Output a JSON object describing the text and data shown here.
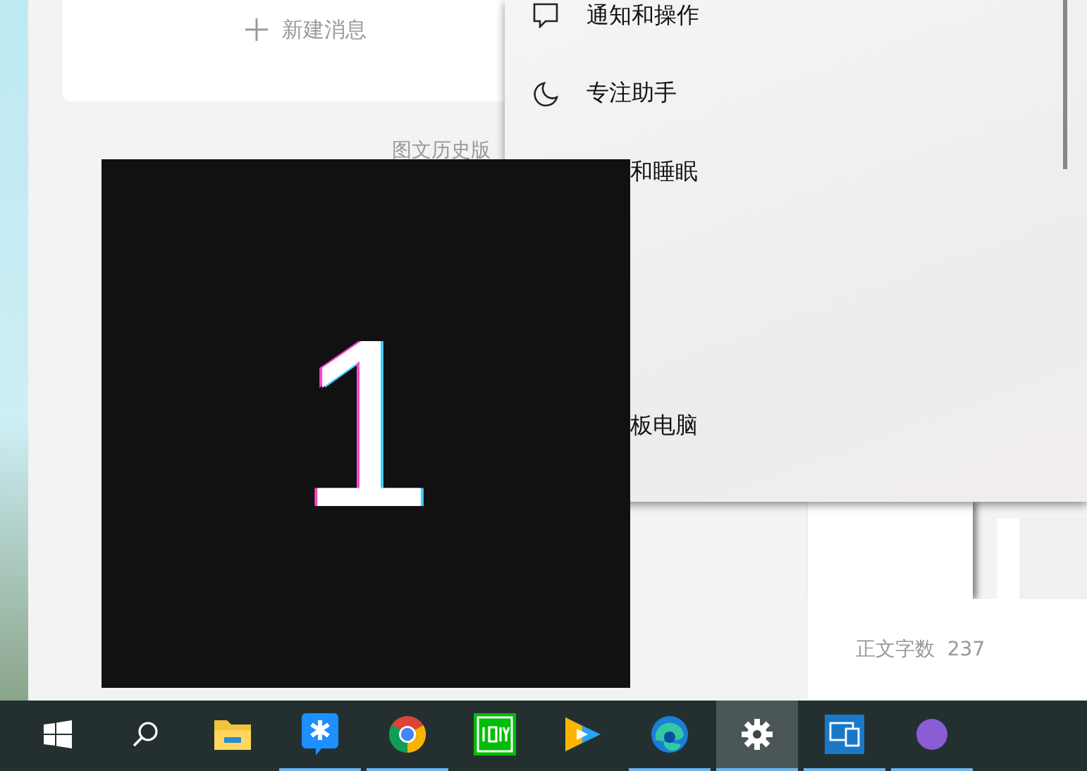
{
  "editor": {
    "new_message": "新建消息",
    "history_link": "图文历史版",
    "word_count_label": "正文字数",
    "word_count": "237"
  },
  "settings_menu": {
    "items": [
      {
        "kind": "notifications",
        "label": "通知和操作"
      },
      {
        "kind": "focus",
        "label": "专注助手"
      },
      {
        "kind": "covered",
        "label": "和睡眠"
      },
      {
        "kind": "hidden"
      },
      {
        "kind": "hidden"
      },
      {
        "kind": "covered",
        "label": "板电脑"
      },
      {
        "kind": "hidden"
      }
    ]
  },
  "display_identify": {
    "number": "1"
  },
  "taskbar": {
    "items": [
      {
        "kind": "start",
        "running": false,
        "selected": false
      },
      {
        "kind": "search",
        "running": false,
        "selected": false
      },
      {
        "kind": "explorer",
        "running": false,
        "selected": false
      },
      {
        "kind": "chat",
        "running": true,
        "selected": false
      },
      {
        "kind": "browser",
        "running": true,
        "selected": false
      },
      {
        "kind": "video",
        "running": false,
        "selected": false
      },
      {
        "kind": "player",
        "running": false,
        "selected": false
      },
      {
        "kind": "edge",
        "running": true,
        "selected": false
      },
      {
        "kind": "settings",
        "running": true,
        "selected": true
      },
      {
        "kind": "remote",
        "running": true,
        "selected": false
      },
      {
        "kind": "circle",
        "running": true,
        "selected": false
      }
    ]
  }
}
